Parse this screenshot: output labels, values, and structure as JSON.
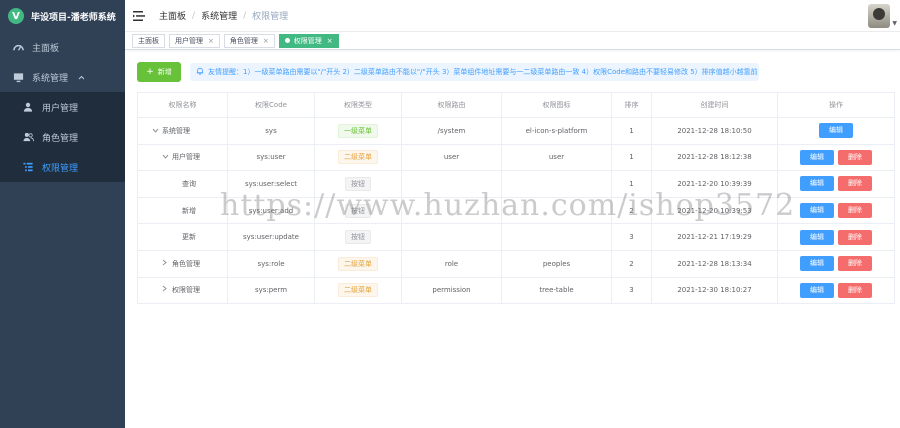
{
  "brand": {
    "logo_letter": "V",
    "title": "毕设项目-潘老师系统",
    "accent": "#42b983"
  },
  "sidebar": {
    "items": [
      {
        "label": "主面板",
        "icon": "dashboard-icon"
      },
      {
        "label": "系统管理",
        "icon": "monitor-icon",
        "expanded": true
      },
      {
        "label": "用户管理",
        "icon": "user-icon"
      },
      {
        "label": "角色管理",
        "icon": "peoples-icon"
      },
      {
        "label": "权限管理",
        "icon": "tree-table-icon",
        "active": true
      }
    ]
  },
  "header": {
    "breadcrumb": [
      "主面板",
      "系统管理",
      "权限管理"
    ]
  },
  "tags": [
    {
      "label": "主面板",
      "closable": false
    },
    {
      "label": "用户管理",
      "closable": true
    },
    {
      "label": "角色管理",
      "closable": true
    },
    {
      "label": "权限管理",
      "closable": true,
      "active": true
    }
  ],
  "toolbar": {
    "add_label": "新增",
    "hint": "友情提醒：1）一级菜单路由需要以\"/\"开头 2）二级菜单路由不能以\"/\"开头 3）菜单组件地址需要与一二级菜单路由一致 4）权限Code和路由不要轻易修改 5）排序值越小越靠前"
  },
  "table": {
    "headers": [
      "权限名称",
      "权限Code",
      "权限类型",
      "权限路由",
      "权限图标",
      "排序",
      "创建时间",
      "操作"
    ],
    "edit_label": "编辑",
    "delete_label": "删除",
    "rows": [
      {
        "name": "系统管理",
        "code": "sys",
        "type": "一级菜单",
        "type_style": "green",
        "route": "/system",
        "icon": "el-icon-s-platform",
        "sort": "1",
        "created": "2021-12-28 18:10:50",
        "caret": "down",
        "indent": 0,
        "deletable": false
      },
      {
        "name": "用户管理",
        "code": "sys:user",
        "type": "二级菜单",
        "type_style": "orange",
        "route": "user",
        "icon": "user",
        "sort": "1",
        "created": "2021-12-28 18:12:38",
        "caret": "down",
        "indent": 1,
        "deletable": true
      },
      {
        "name": "查询",
        "code": "sys:user:select",
        "type": "按钮",
        "type_style": "gray",
        "route": "",
        "icon": "",
        "sort": "1",
        "created": "2021-12-20 10:39:39",
        "caret": "",
        "indent": 2,
        "deletable": true
      },
      {
        "name": "新增",
        "code": "sys:user:add",
        "type": "按钮",
        "type_style": "gray",
        "route": "",
        "icon": "",
        "sort": "2",
        "created": "2021-12-20 10:39:53",
        "caret": "",
        "indent": 2,
        "deletable": true
      },
      {
        "name": "更新",
        "code": "sys:user:update",
        "type": "按钮",
        "type_style": "gray",
        "route": "",
        "icon": "",
        "sort": "3",
        "created": "2021-12-21 17:19:29",
        "caret": "",
        "indent": 2,
        "deletable": true
      },
      {
        "name": "角色管理",
        "code": "sys:role",
        "type": "二级菜单",
        "type_style": "orange",
        "route": "role",
        "icon": "peoples",
        "sort": "2",
        "created": "2021-12-28 18:13:34",
        "caret": "right",
        "indent": 1,
        "deletable": true
      },
      {
        "name": "权限管理",
        "code": "sys:perm",
        "type": "二级菜单",
        "type_style": "orange",
        "route": "permission",
        "icon": "tree-table",
        "sort": "3",
        "created": "2021-12-30 18:10:27",
        "caret": "right",
        "indent": 1,
        "deletable": true
      }
    ]
  },
  "watermark": "https://www.huzhan.com/ishop3572"
}
